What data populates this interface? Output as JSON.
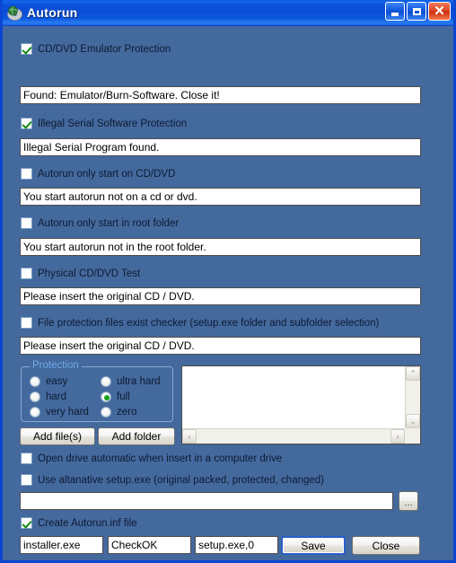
{
  "window": {
    "title": "Autorun",
    "icon": "cd-globe-icon",
    "accent_titlebar": "#0b4ed4",
    "client_background": "#44699d",
    "border_color": "#0a46d2"
  },
  "titlebar_buttons": {
    "minimize": {
      "name": "minimize-button",
      "glyph": "_"
    },
    "maximize": {
      "name": "maximize-button",
      "glyph": "□"
    },
    "close": {
      "name": "close-button",
      "glyph": "✕"
    }
  },
  "options": [
    {
      "id": "cd-dvd-emulator-protection",
      "label": "CD/DVD Emulator Protection",
      "checked": true,
      "message": "Found: Emulator/Burn-Software. Close it!"
    },
    {
      "id": "illegal-serial-software-protection",
      "label": "Illegal Serial Software Protection",
      "checked": true,
      "message": "Illegal Serial Program found."
    },
    {
      "id": "autorun-only-start-on-cd-dvd",
      "label": "Autorun only start on CD/DVD",
      "checked": false,
      "message": "You start autorun not on a cd or dvd."
    },
    {
      "id": "autorun-only-start-in-root-folder",
      "label": "Autorun only start in root folder",
      "checked": false,
      "message": "You start autorun not in the root folder."
    },
    {
      "id": "physical-cd-dvd-test",
      "label": "Physical CD/DVD Test",
      "checked": false,
      "message": "Please insert the original CD / DVD."
    },
    {
      "id": "file-protection-files-exist-checker",
      "label": "File protection files exist checker (setup.exe folder and subfolder selection)",
      "checked": false,
      "message": "Please insert the original CD / DVD."
    }
  ],
  "protection_group": {
    "legend": "Protection",
    "legend_color": "#6fa8e8",
    "selected": "full",
    "left_column": [
      {
        "id": "easy",
        "label": "easy",
        "selected": false
      },
      {
        "id": "hard",
        "label": "hard",
        "selected": false
      },
      {
        "id": "very-hard",
        "label": "very hard",
        "selected": false
      }
    ],
    "right_column": [
      {
        "id": "ultra-hard",
        "label": "ultra hard",
        "selected": false
      },
      {
        "id": "full",
        "label": "full",
        "selected": true
      },
      {
        "id": "zero",
        "label": "zero",
        "selected": false
      }
    ]
  },
  "file_buttons": {
    "add_files": "Add file(s)",
    "add_folder": "Add folder"
  },
  "file_list": {
    "items": [],
    "scroll_up": "⌃",
    "scroll_down": "⌄",
    "scroll_left": "‹",
    "scroll_right": "›"
  },
  "bottom_options": [
    {
      "id": "open-drive-automatic",
      "label": "Open drive automatic when insert in a computer drive",
      "checked": false
    },
    {
      "id": "use-alternative-setup-exe",
      "label": "Use altanative setup.exe (original packed, protected, changed)",
      "checked": false
    }
  ],
  "alternative_setup_path": {
    "value": "",
    "placeholder": "",
    "browse_label": "..."
  },
  "create_autorun": {
    "label": "Create Autorun.inf file",
    "checked": true
  },
  "autorun_fields": [
    {
      "id": "autorun-icon-field",
      "value": "installer.exe"
    },
    {
      "id": "autorun-label-field",
      "value": "CheckOK"
    },
    {
      "id": "autorun-open-field",
      "value": "setup.exe,0"
    }
  ],
  "action_buttons": {
    "save": "Save",
    "close": "Close"
  }
}
